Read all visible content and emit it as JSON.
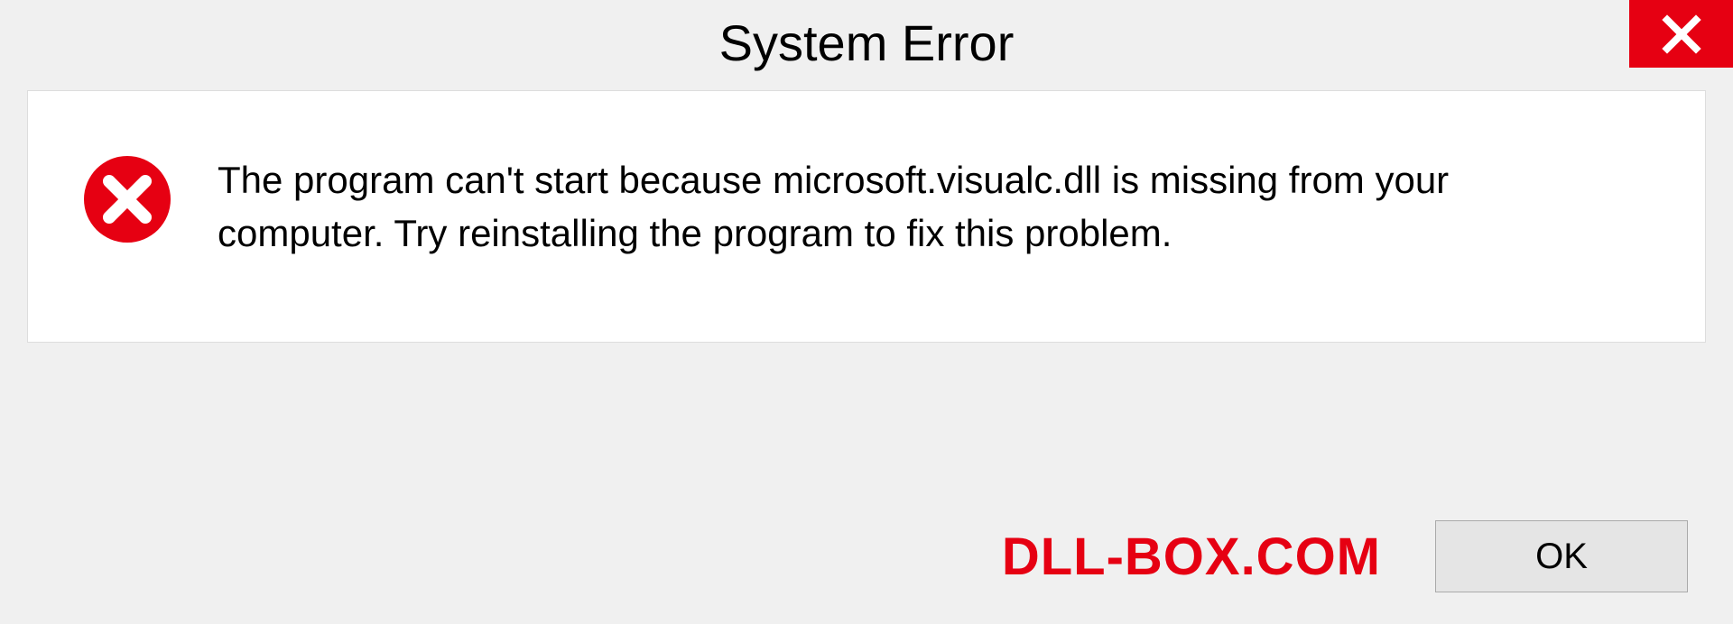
{
  "dialog": {
    "title": "System Error",
    "message": "The program can't start because microsoft.visualc.dll is missing from your computer. Try reinstalling the program to fix this problem.",
    "ok_label": "OK"
  },
  "watermark": "DLL-BOX.COM",
  "colors": {
    "accent_red": "#e60012",
    "background": "#f0f0f0",
    "panel_bg": "#ffffff"
  }
}
